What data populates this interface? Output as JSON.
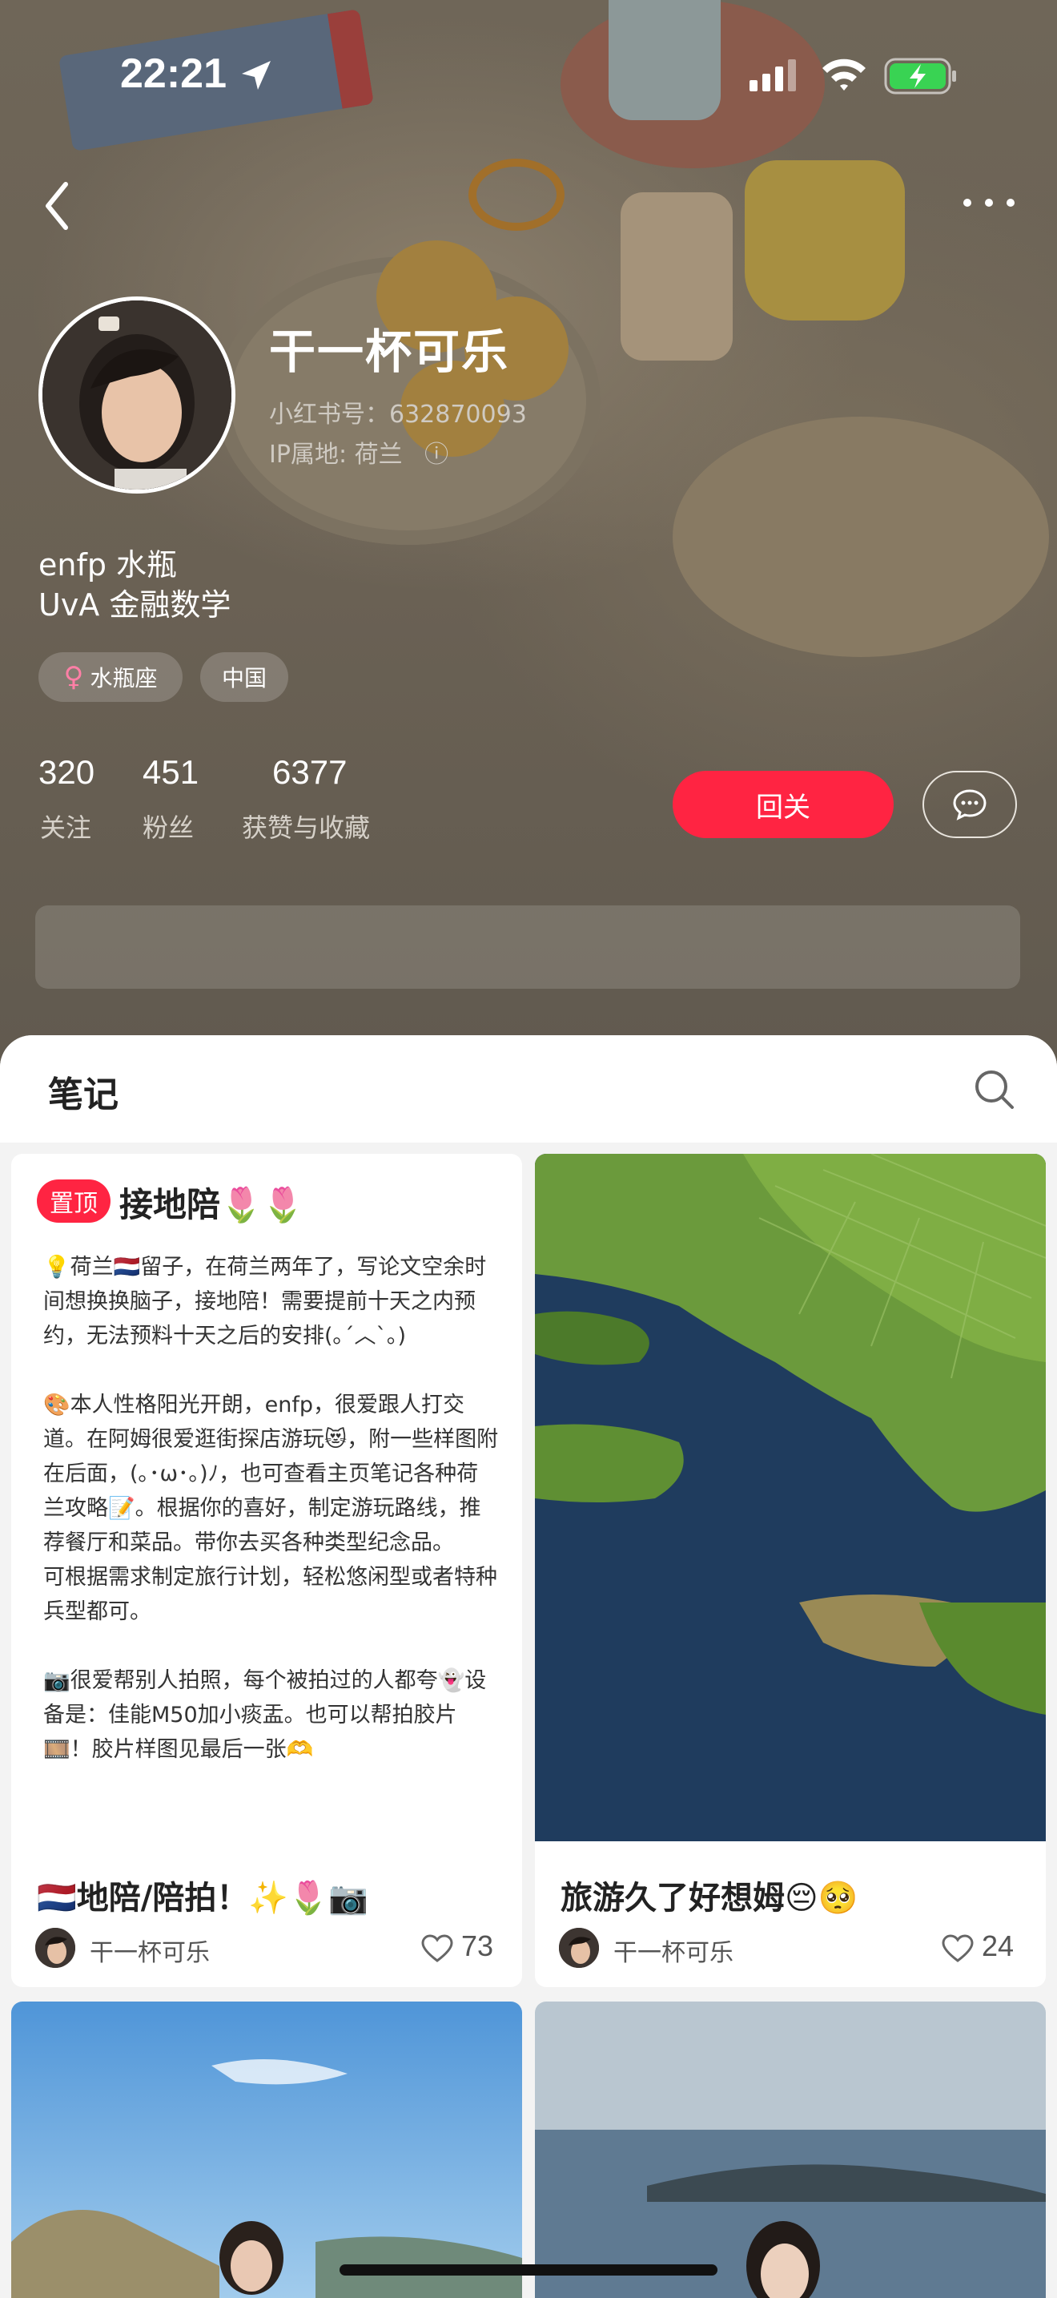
{
  "status_bar": {
    "time": "22:21"
  },
  "profile": {
    "name": "干一杯可乐",
    "red_id": "小红书号：632870093",
    "ip_location": "IP属地: 荷兰",
    "info_icon": "ⓘ",
    "bio_line1": "enfp 水瓶",
    "bio_line2": "UvA 金融数学",
    "tags": [
      {
        "icon": "♀",
        "label": "水瓶座"
      },
      {
        "label": "中国"
      }
    ],
    "stats": [
      {
        "value": "320",
        "label": "关注"
      },
      {
        "value": "451",
        "label": "粉丝"
      },
      {
        "value": "6377",
        "label": "获赞与收藏"
      }
    ],
    "follow_back_label": "回关"
  },
  "notes_section": {
    "title": "笔记"
  },
  "cards": [
    {
      "pinned_label": "置顶",
      "cover_title": "接地陪🌷🌷",
      "cover_text": "💡荷兰🇳🇱留子，在荷兰两年了，写论文空余时间想换换脑子，接地陪！需要提前十天之内预约，无法预料十天之后的安排(｡´︿`｡)\n\n🎨本人性格阳光开朗，enfp，很爱跟人打交道。在阿姆很爱逛街探店游玩😻，附一些样图附在后面，(｡･ω･｡)ﾉ，也可查看主页笔记各种荷兰攻略📝。根据你的喜好，制定游玩路线，推荐餐厅和菜品。带你去买各种类型纪念品。\n可根据需求制定旅行计划，轻松悠闲型或者特种兵型都可。\n\n📷很爱帮别人拍照，每个被拍过的人都夸👻设备是：佳能M50加小痰盂。也可以帮拍胶片🎞️！胶片样图见最后一张🫶",
      "title": "🇳🇱地陪/陪拍！✨🌷📷",
      "author": "干一杯可乐",
      "likes": "73"
    },
    {
      "title": "旅游久了好想姆😔🥺",
      "author": "干一杯可乐",
      "likes": "24"
    }
  ],
  "colors": {
    "accent": "#ff2442",
    "header_bg": "#6a6154"
  },
  "icons": [
    "location-arrow-icon",
    "signal-icon",
    "wifi-icon",
    "battery-icon",
    "back-icon",
    "more-icon",
    "chat-bubble-icon",
    "search-icon",
    "heart-icon",
    "info-icon"
  ]
}
